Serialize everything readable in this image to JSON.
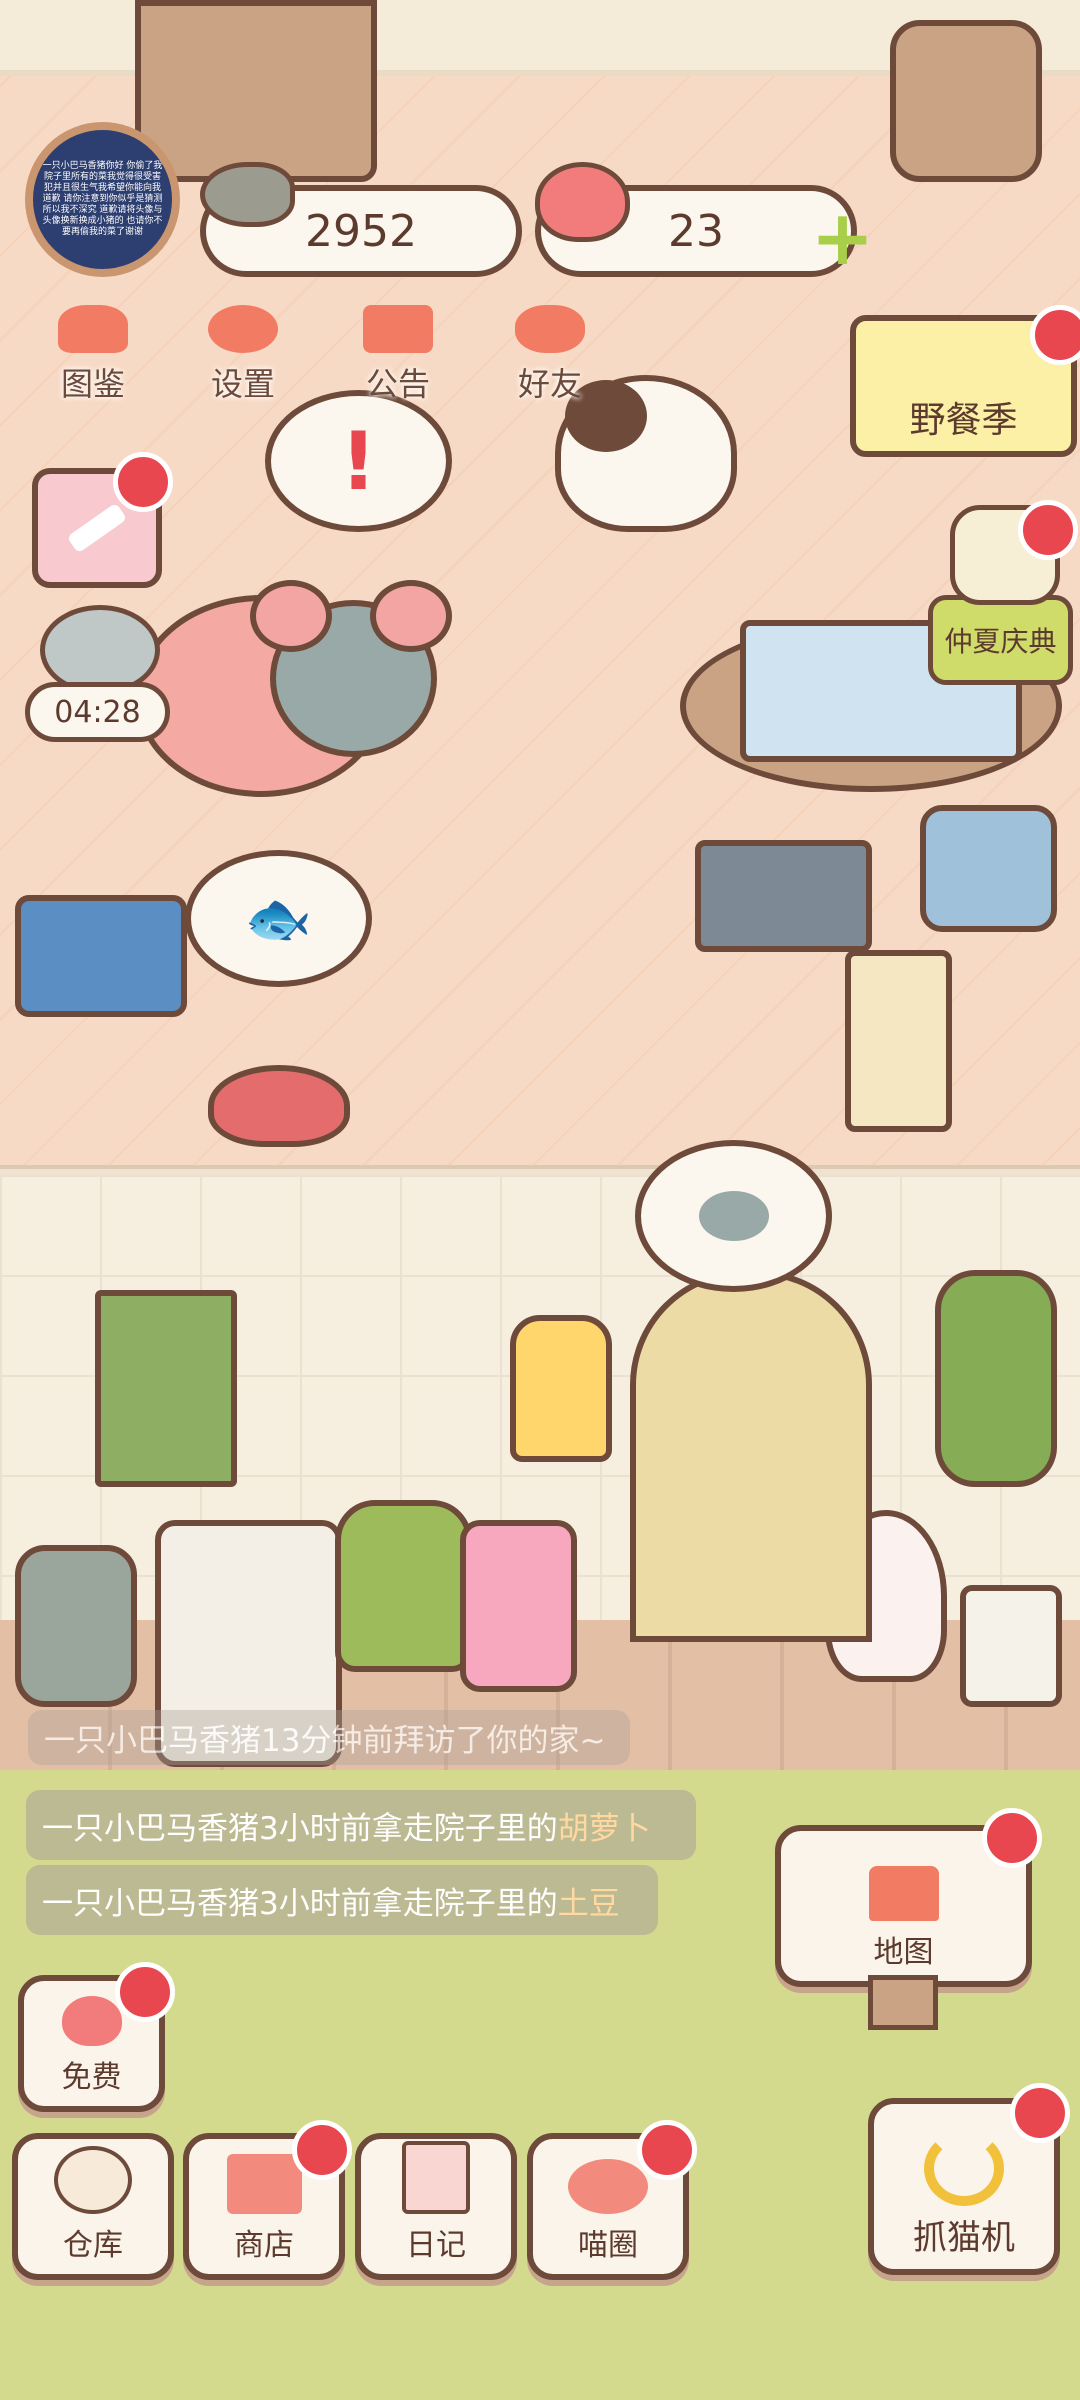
{
  "currency": {
    "fish": "2952",
    "hearts": "23"
  },
  "avatar_text": "一只小巴马香猪你好 你偷了我院子里所有的菜我觉得很受害犯并且很生气我希望你能向我道歉 请你注意到你似乎是猜测所以我不深究 道歉请将头像与头像换新换成小猪的 也请你不要再偷我的菜了谢谢",
  "top_menu": [
    {
      "label": "图鉴",
      "icon": "cat-book-icon"
    },
    {
      "label": "设置",
      "icon": "gear-icon"
    },
    {
      "label": "公告",
      "icon": "gift-icon"
    },
    {
      "label": "好友",
      "icon": "friends-icon"
    }
  ],
  "events": {
    "picnic": "野餐季",
    "festival": "仲夏庆典"
  },
  "timer": "04:28",
  "feed": {
    "line1": "一只小巴马香猪13分钟前拜访了你的家~",
    "line2_prefix": "一只小巴马香猪3小时前拿走院子里的",
    "line2_item": "胡萝卜",
    "line3_prefix": "一只小巴马香猪3小时前拿走院子里的",
    "line3_item": "土豆"
  },
  "buttons": {
    "map": "地图",
    "free": "免费",
    "warehouse": "仓库",
    "shop": "商店",
    "diary": "日记",
    "circle": "喵圈",
    "claw": "抓猫机"
  },
  "colors": {
    "accent": "#f27b63",
    "badge": "#e9474f",
    "outline": "#6e4a3a",
    "grass": "#d3da8e"
  }
}
